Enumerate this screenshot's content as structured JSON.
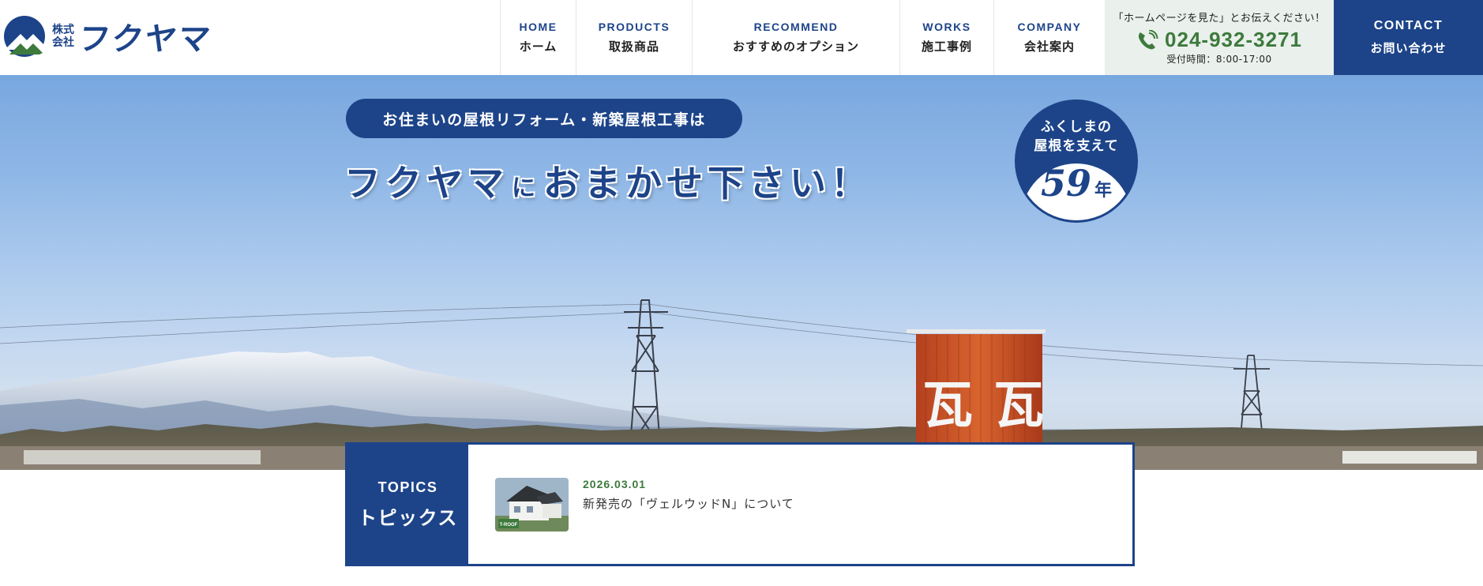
{
  "brand": {
    "kabushiki": "株式",
    "kaisha": "会社",
    "name": "フクヤマ",
    "primary_color": "#1d4489",
    "green_color": "#3d7a3c"
  },
  "nav": [
    {
      "en": "HOME",
      "ja": "ホーム"
    },
    {
      "en": "PRODUCTS",
      "ja": "取扱商品"
    },
    {
      "en": "RECOMMEND",
      "ja": "おすすめのオプション"
    },
    {
      "en": "WORKS",
      "ja": "施工事例"
    },
    {
      "en": "COMPANY",
      "ja": "会社案内"
    }
  ],
  "tel": {
    "note": "「ホームページを見た」とお伝えください！",
    "number": "024-932-3271",
    "hours": "受付時間：8:00-17:00",
    "icon": "phone-icon"
  },
  "contact": {
    "en": "CONTACT",
    "ja": "お問い合わせ"
  },
  "hero": {
    "pill": "お住まいの屋根リフォーム・新築屋根工事は",
    "headline_a": "フクヤマ",
    "headline_b": "に",
    "headline_c": "おまかせ下さい！",
    "years_line1": "ふくしまの",
    "years_line2": "屋根を支えて",
    "years_num": "59",
    "years_unit": "年",
    "sign_char_1": "瓦",
    "sign_char_2": "瓦"
  },
  "topics": {
    "label_en": "TOPICS",
    "label_ja": "トピックス",
    "items": [
      {
        "date": "2026.03.01",
        "title": "新発売の「ヴェルウッドN」について",
        "thumb_label": "T-ROOF"
      }
    ]
  }
}
